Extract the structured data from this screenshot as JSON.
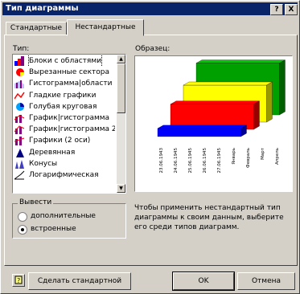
{
  "window": {
    "title": "Тип диаграммы"
  },
  "titlebar_buttons": {
    "help": "?",
    "close": "X"
  },
  "tabs": [
    {
      "label": "Стандартные",
      "active": false
    },
    {
      "label": "Нестандартные",
      "active": true
    }
  ],
  "type_list": {
    "label": "Тип:",
    "items": [
      {
        "label": "Блоки с областями",
        "icon": "blocks-area-icon",
        "selected": true
      },
      {
        "label": "Вырезанные сектора",
        "icon": "exploded-pie-icon",
        "selected": false
      },
      {
        "label": "Гистограмма|области",
        "icon": "column-area-icon",
        "selected": false
      },
      {
        "label": "Гладкие графики",
        "icon": "smooth-line-icon",
        "selected": false
      },
      {
        "label": "Голубая круговая",
        "icon": "blue-pie-icon",
        "selected": false
      },
      {
        "label": "График|гистограмма",
        "icon": "line-column-icon",
        "selected": false
      },
      {
        "label": "График|гистограмма 2",
        "icon": "line-column-2-icon",
        "selected": false
      },
      {
        "label": "Графики (2 оси)",
        "icon": "lines-2-axes-icon",
        "selected": false
      },
      {
        "label": "Деревянная",
        "icon": "wooden-chart-icon",
        "selected": false
      },
      {
        "label": "Конусы",
        "icon": "cones-icon",
        "selected": false
      },
      {
        "label": "Логарифмическая",
        "icon": "log-chart-icon",
        "selected": false
      }
    ]
  },
  "source_group": {
    "label": "Вывести",
    "options": [
      {
        "label": "дополнительные",
        "checked": false
      },
      {
        "label": "встроенные",
        "checked": true
      }
    ]
  },
  "preview": {
    "label": "Образец:",
    "chart_data": {
      "type": "bar",
      "categories": [
        "23.06.1943",
        "24.06.1945",
        "25.06.1945",
        "26.06.1945",
        "27.06.1945",
        "Январь",
        "Февраль",
        "Март",
        "Апрель"
      ],
      "series": [
        {
          "values": [
            1.1,
            1.1,
            1.1,
            1.1,
            1.1,
            1.1,
            1.1,
            1.1,
            1.1
          ]
        },
        {
          "values": [
            3.4,
            3.4,
            3.4,
            3.4,
            3.4,
            3.4,
            3.4,
            3.4,
            3.4
          ]
        },
        {
          "values": [
            5.0,
            5.0,
            5.0,
            5.0,
            5.0,
            5.0,
            5.0,
            5.0,
            5.0
          ]
        },
        {
          "values": [
            7.0,
            7.0,
            7.0,
            7.0,
            7.0,
            7.0,
            7.0,
            7.0,
            7.0
          ]
        }
      ],
      "series_colors": [
        "#0000ff",
        "#ff0000",
        "#ffff00",
        "#00a000"
      ],
      "ylim": [
        0,
        7
      ],
      "yticks": [
        "0",
        "1",
        "2",
        "3",
        "4",
        "5",
        "6",
        "7"
      ]
    }
  },
  "description": "Чтобы применить нестандартный тип диаграммы к своим данным, выберите его среди типов диаграмм.",
  "buttons": {
    "set_default": "Сделать стандартной",
    "ok": "OK",
    "cancel": "Отмена"
  }
}
